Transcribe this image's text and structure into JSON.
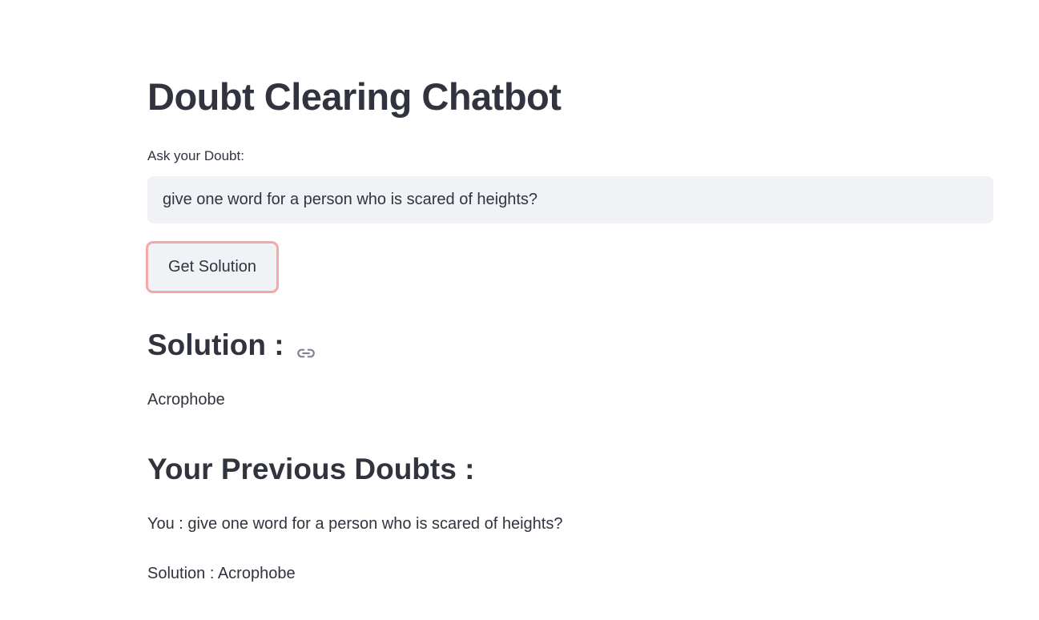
{
  "page": {
    "title": "Doubt Clearing Chatbot"
  },
  "question_input": {
    "label": "Ask your Doubt:",
    "value": "give one word for a person who is scared of heights?"
  },
  "actions": {
    "get_solution_label": "Get Solution"
  },
  "solution": {
    "heading": "Solution :",
    "link_icon": "link-icon",
    "answer": "Acrophobe"
  },
  "history": {
    "heading": "Your Previous Doubts :",
    "entries": [
      {
        "question": "You : give one word for a person who is scared of heights?",
        "answer": "Solution : Acrophobe"
      }
    ]
  },
  "colors": {
    "text": "#31333f",
    "input_background": "#f0f2f6",
    "button_focus_border": "#f5a6a6",
    "icon": "#808495"
  }
}
